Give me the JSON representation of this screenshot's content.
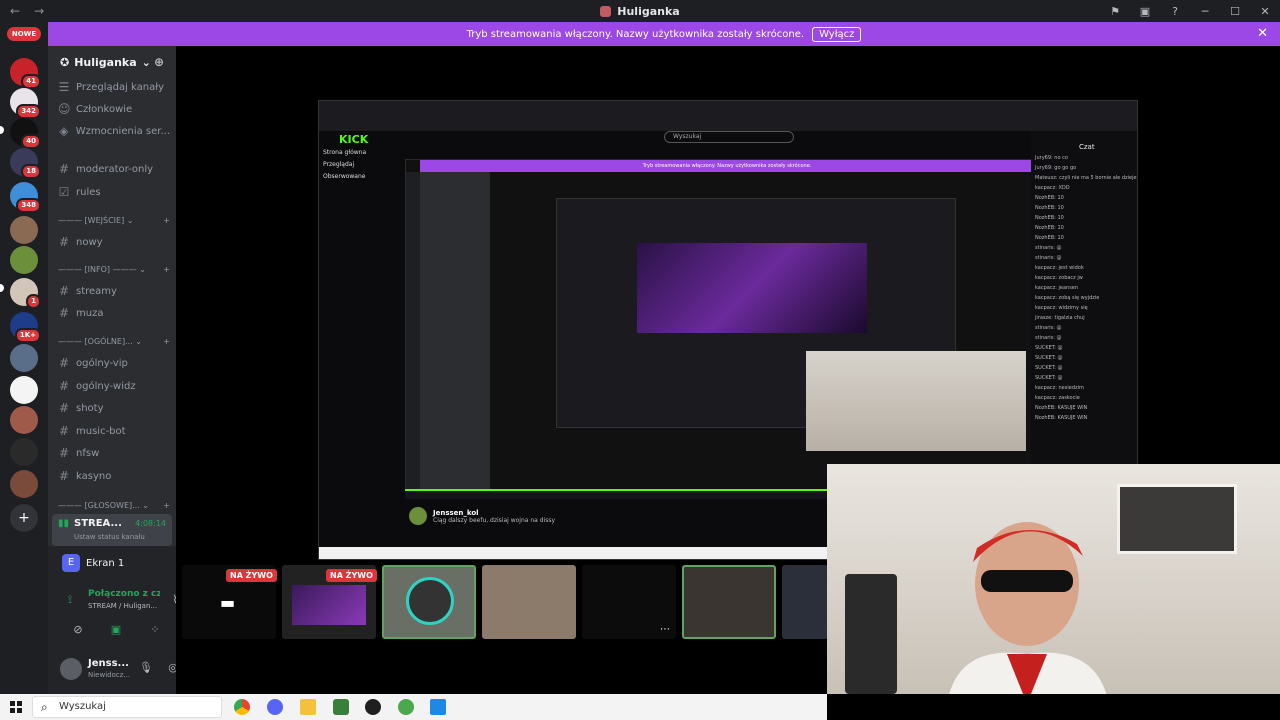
{
  "window": {
    "title": "Huliganka",
    "nav_back": "←",
    "nav_forward": "→"
  },
  "banner": {
    "text": "Tryb streamowania włączony. Nazwy użytkownika zostały skrócone.",
    "button": "Wyłącz"
  },
  "rail": {
    "new_label": "NOWE",
    "badges": [
      "41",
      "342",
      "40",
      "18",
      "348",
      "1",
      "1K+"
    ]
  },
  "sidebar": {
    "server_name": "Huliganka",
    "items": [
      {
        "label": "Przeglądaj kanały",
        "icon": "browse-icon"
      },
      {
        "label": "Członkowie",
        "icon": "members-icon"
      },
      {
        "label": "Wzmocnienia ser...",
        "icon": "boost-icon"
      },
      {
        "label": "moderator-only",
        "icon": "hash-icon"
      },
      {
        "label": "rules",
        "icon": "rules-icon"
      }
    ],
    "categories": [
      "[WEJŚCIE]",
      "[INFO]",
      "[OGÓLNE]",
      "[GŁOSOWE]"
    ],
    "channels_wejscie": [
      "nowy"
    ],
    "channels_info": [
      "streamy",
      "muza"
    ],
    "channels_ogolne": [
      "ogólny-vip",
      "ogólny-widz",
      "shoty",
      "music-bot",
      "nfsw",
      "kasyno"
    ],
    "voice": {
      "name": "STREA...",
      "time": "4:08:14",
      "status": "Ustaw status kanału"
    }
  },
  "panel": {
    "screen_label": "Ekran 1",
    "screen_initial": "E",
    "connected": "Połączono z czat",
    "connected_sub": "STREAM / Huligan...",
    "user_name": "Jenss...",
    "user_status": "Niewidocz..."
  },
  "share": {
    "kick_logo": "KICK",
    "search_placeholder": "Wyszukaj",
    "chat_caption": "Czat",
    "nav": [
      "Strona główna",
      "Przeglądaj",
      "Obserwowane"
    ],
    "streamer_name": "Jenssen_kol",
    "streamer_title": "Ciąg dalszy beefu, dzisiaj wojna na dissy",
    "inner_banner": "Tryb streamowania włączony. Nazwy użytkownika zostały skrócone.",
    "chat": [
      "Jury69: no co",
      "Jury69: go go go",
      "Mateusz: czyli nie ma 5 bornie ale dzieje",
      "kacpacz: XDD",
      "NozhEB: 10",
      "NozhEB: 10",
      "NozhEB: 10",
      "NozhEB: 10",
      "NozhEB: 10",
      "stinaris: @",
      "stinaris: @",
      "kacpacz: jest widok",
      "kacpacz: zobacz jw",
      "kacpacz: jeansen",
      "kacpacz: zobą się wyjdzie",
      "kacpacz: widzimy się",
      "jirasze: tigalzia chuj",
      "stinaris: @",
      "stinaris: @",
      "SUCKET: @",
      "SUCKET: @",
      "SUCKET: @",
      "SUCKET: @",
      "kacpacz: nesiedzim",
      "kacpacz: zaskocie",
      "NozhEB: KASUJE WIN",
      "NozhEB: KASUJE WIN"
    ]
  },
  "thumbnails": {
    "live_label": "NA ŻYWO"
  },
  "taskbar": {
    "search": "Wyszukaj"
  }
}
